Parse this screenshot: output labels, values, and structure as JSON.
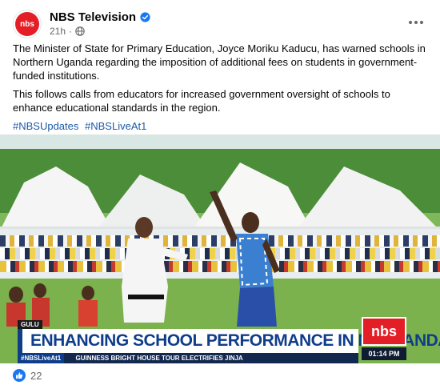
{
  "post": {
    "author": "NBS Television",
    "avatar_text": "nbs",
    "timestamp": "21h",
    "separator": "·",
    "paragraphs": [
      "The Minister of State for Primary Education, Joyce Moriku Kaducu, has warned schools in Northern Uganda regarding the imposition of additional fees on students in government-funded institutions.",
      "This follows calls from educators for increased government oversight of schools to enhance educational standards in the region."
    ],
    "hashtags": [
      "#NBSUpdates",
      "#NBSLiveAt1"
    ]
  },
  "video": {
    "location_label": "GULU",
    "headline": "ENHANCING SCHOOL PERFORMANCE IN N. UGANDA",
    "logo_text": "nbs",
    "ticker_tag": "#NBSLiveAt1",
    "ticker_text": "GUINNESS BRIGHT HOUSE TOUR ELECTRIFIES JINJA",
    "clock": "01:14 PM"
  },
  "reactions": {
    "count": "22"
  },
  "colors": {
    "brand_red": "#e41e26",
    "link_blue": "#1d5aa7",
    "facebook_blue": "#1877f2",
    "broadcast_blue": "#0f3d8a"
  }
}
